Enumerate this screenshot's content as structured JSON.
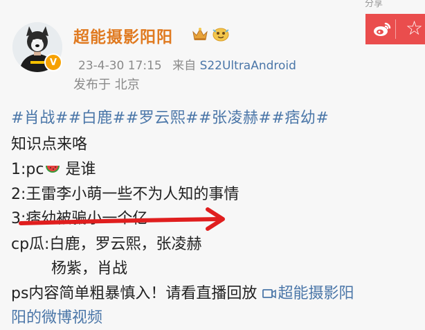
{
  "top_fragment": "分享",
  "post": {
    "username": "超能摄影阳阳",
    "time": "23-4-30 17:15",
    "from_label": "来自",
    "source": "S22UltraAndroid",
    "location": "发布于 北京",
    "hashtags": "#肖战##白鹿##罗云熙##张凌赫##痞幼#",
    "lines": [
      "知识点来咯",
      "1:pc",
      "是谁",
      "2:王雷李小萌一些不为人知的事情",
      "3:痞幼被骗小一个亿",
      "cp瓜:白鹿，罗云熙，张凌赫",
      "杨紫，肖战",
      "ps内容简单粗暴慎入！请看直播回放"
    ],
    "video_link_1": "超能摄影阳",
    "video_link_2": "阳的微博视频"
  },
  "colors": {
    "username": "#e07a20",
    "link": "#4a76a8",
    "share_bar": "#ea4d4d",
    "arrow": "#e01e1e"
  },
  "icons": [
    "verified-v-icon",
    "crown-icon",
    "medal-icon",
    "watermelon-icon",
    "weibo-share-icon",
    "star-icon",
    "video-icon",
    "red-arrow"
  ]
}
